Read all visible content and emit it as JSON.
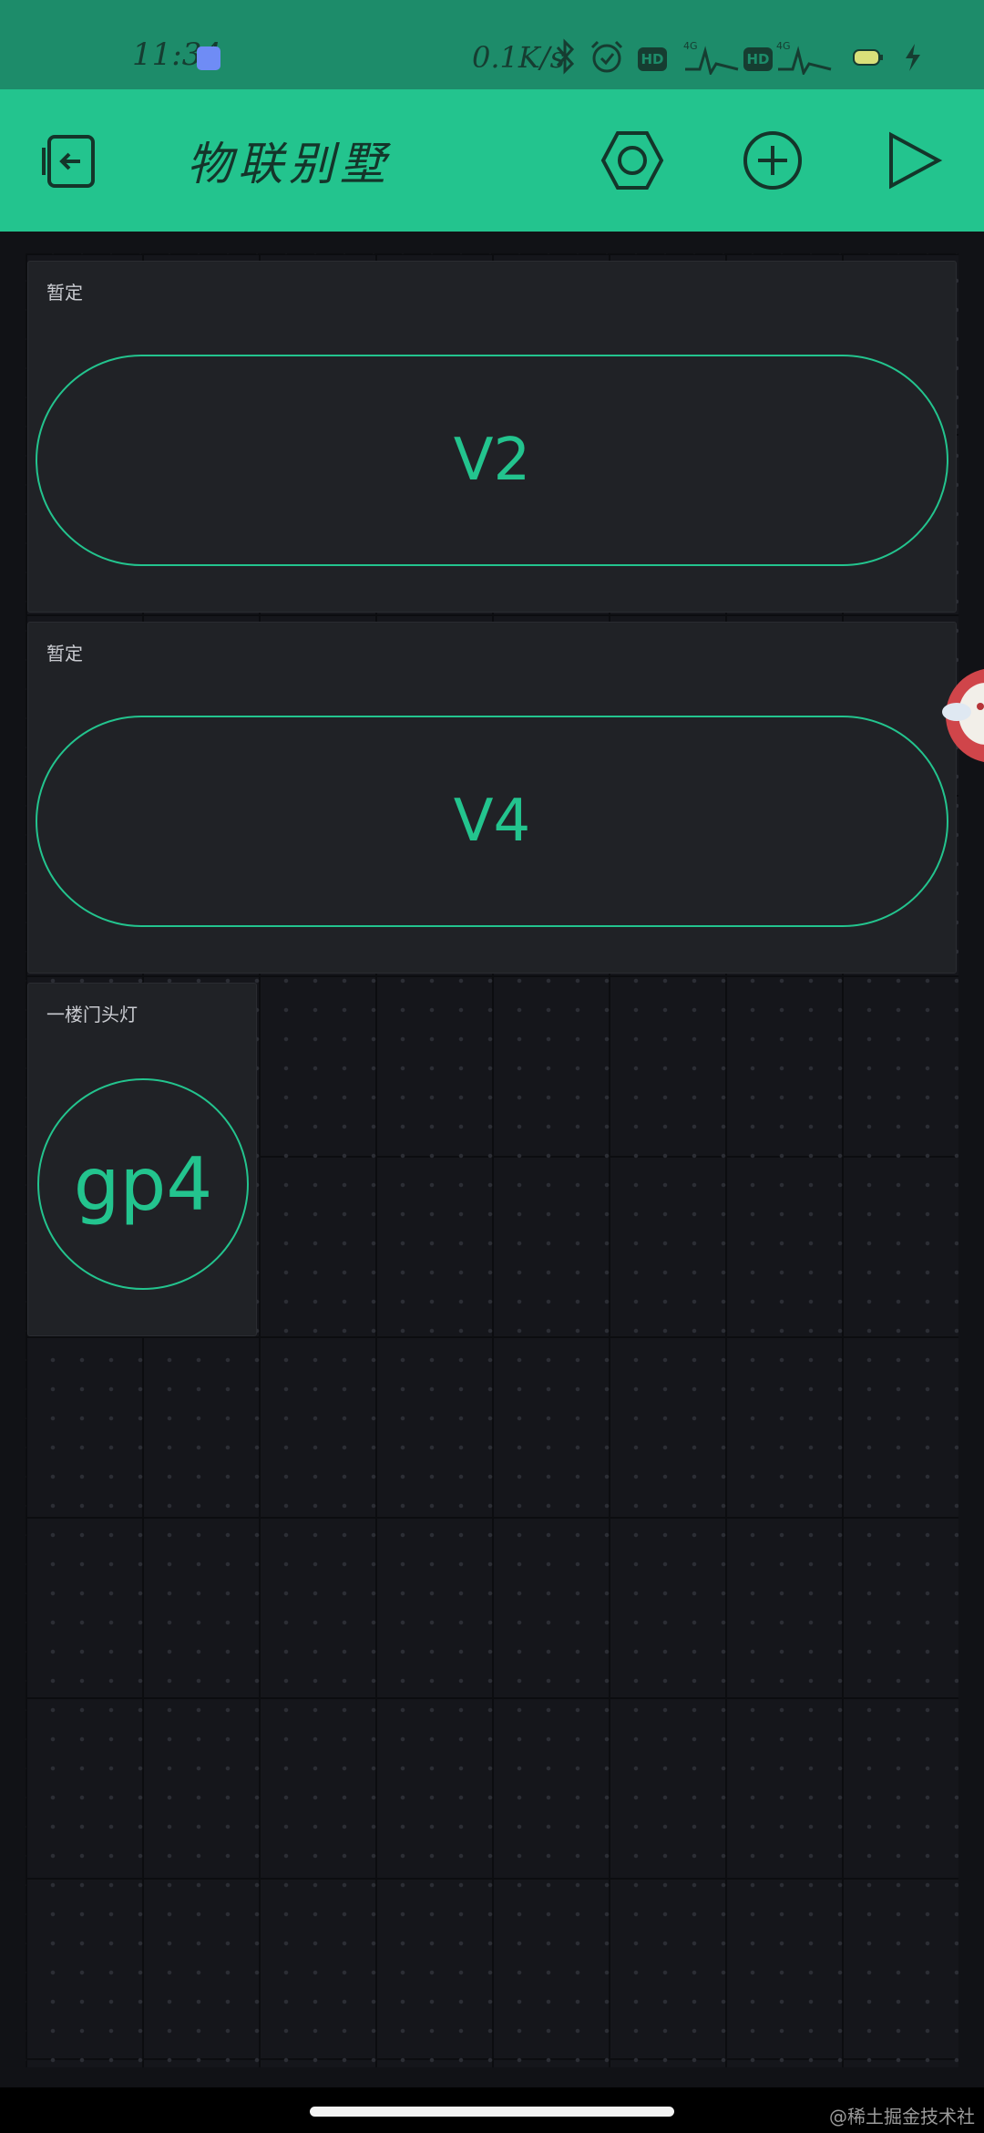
{
  "status_bar": {
    "time": "11:34",
    "miui_badge": "MIUI",
    "net_speed": "0.1K/s",
    "hd1": "HD",
    "hd2": "HD",
    "net1": "4G",
    "net2": "4G",
    "icons": [
      "bluetooth-icon",
      "alarm-icon",
      "hd-icon",
      "signal-icon",
      "hd-icon",
      "signal-icon",
      "battery-icon",
      "charging-icon"
    ]
  },
  "header": {
    "title": "物联别墅",
    "icons": [
      "exit-icon",
      "settings-hexagon-icon",
      "add-circle-icon",
      "play-icon"
    ]
  },
  "widgets": [
    {
      "label": "暂定",
      "button_text": "V2"
    },
    {
      "label": "暂定",
      "button_text": "V4"
    },
    {
      "label": "一楼门头灯",
      "button_text": "gp4"
    }
  ],
  "watermark": "@稀土掘金技术社区",
  "colors": {
    "accent": "#23c48e",
    "status_bar": "#1d8c6a",
    "background": "#111216",
    "widget": "#202226"
  }
}
